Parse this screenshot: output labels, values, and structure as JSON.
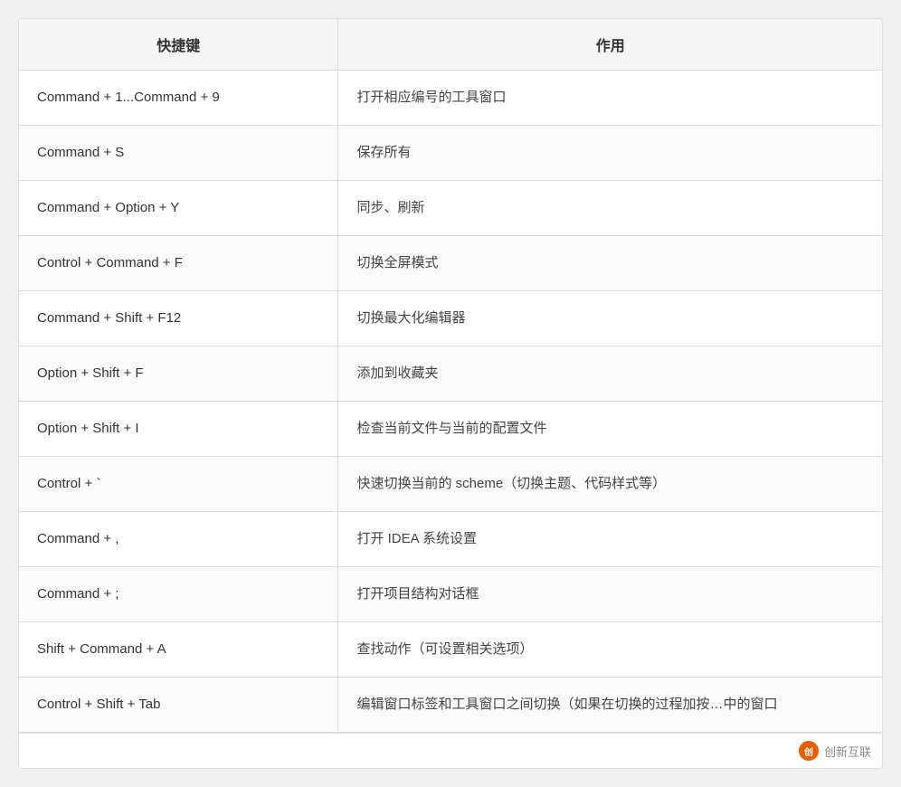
{
  "table": {
    "headers": [
      "快捷键",
      "作用"
    ],
    "rows": [
      {
        "shortcut": "Command + 1...Command + 9",
        "description": "打开相应编号的工具窗口"
      },
      {
        "shortcut": "Command + S",
        "description": "保存所有"
      },
      {
        "shortcut": "Command + Option + Y",
        "description": "同步、刷新"
      },
      {
        "shortcut": "Control + Command + F",
        "description": "切换全屏模式"
      },
      {
        "shortcut": "Command + Shift + F12",
        "description": "切换最大化编辑器"
      },
      {
        "shortcut": "Option + Shift + F",
        "description": "添加到收藏夹"
      },
      {
        "shortcut": "Option + Shift + I",
        "description": "检查当前文件与当前的配置文件"
      },
      {
        "shortcut": "Control + `",
        "description": "快速切换当前的 scheme（切换主题、代码样式等）"
      },
      {
        "shortcut": "Command + ,",
        "description": "打开 IDEA 系统设置"
      },
      {
        "shortcut": "Command + ;",
        "description": "打开项目结构对话框"
      },
      {
        "shortcut": "Shift + Command + A",
        "description": "查找动作（可设置相关选项）"
      },
      {
        "shortcut": "Control + Shift + Tab",
        "description": "编辑窗口标签和工具窗口之间切换（如果在切换的过程加按…中的窗口"
      }
    ]
  },
  "watermark": {
    "icon_text": "创",
    "label": "创新互联"
  }
}
